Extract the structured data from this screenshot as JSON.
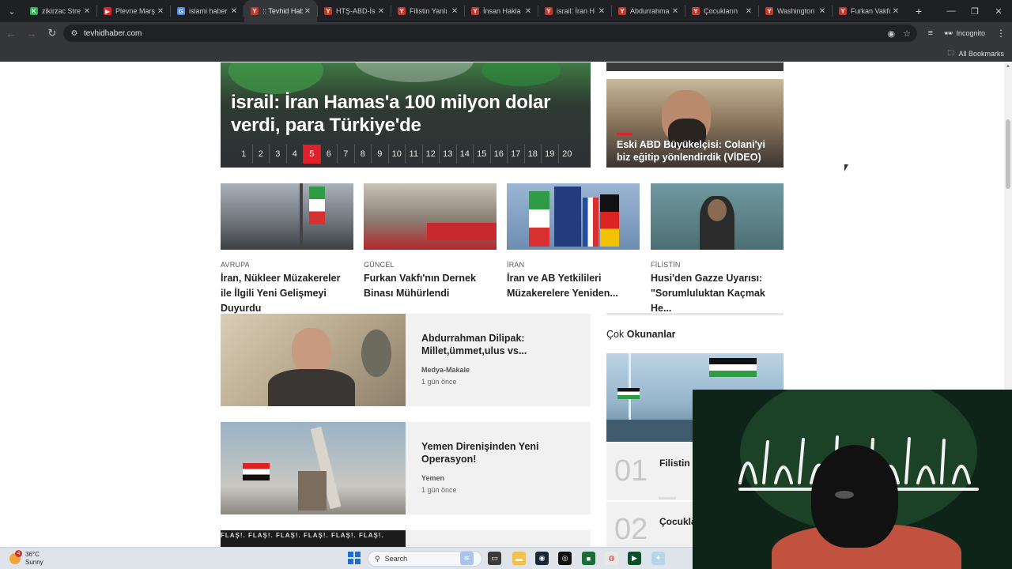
{
  "tabs": [
    {
      "label": "zikirzac Stre",
      "fav_color": "#2bb24c",
      "fav_glyph": "K",
      "active": false
    },
    {
      "label": "Plevne Marş",
      "fav_color": "#e02424",
      "fav_glyph": "▶",
      "active": false
    },
    {
      "label": "islami haber",
      "fav_color": "#4a8af4",
      "fav_glyph": "G",
      "active": false
    },
    {
      "label": ":: Tevhid Hab",
      "fav_color": "#c0392b",
      "fav_glyph": "Y",
      "active": true
    },
    {
      "label": "HTŞ-ABD-İs",
      "fav_color": "#c0392b",
      "fav_glyph": "Y",
      "active": false
    },
    {
      "label": "Filistin Yanlı",
      "fav_color": "#c0392b",
      "fav_glyph": "Y",
      "active": false
    },
    {
      "label": "İnsan Hakla",
      "fav_color": "#c0392b",
      "fav_glyph": "Y",
      "active": false
    },
    {
      "label": "israil: İran H",
      "fav_color": "#c0392b",
      "fav_glyph": "Y",
      "active": false
    },
    {
      "label": "Abdurrahma",
      "fav_color": "#c0392b",
      "fav_glyph": "Y",
      "active": false
    },
    {
      "label": "Çocukların",
      "fav_color": "#c0392b",
      "fav_glyph": "Y",
      "active": false
    },
    {
      "label": "Washington",
      "fav_color": "#c0392b",
      "fav_glyph": "Y",
      "active": false
    },
    {
      "label": "Furkan Vakfı",
      "fav_color": "#c0392b",
      "fav_glyph": "Y",
      "active": false
    }
  ],
  "omnibox": {
    "url": "tevhidhaber.com"
  },
  "toolbar": {
    "incognito_label": "Incognito"
  },
  "bookmarks": {
    "all_label": "All Bookmarks"
  },
  "hero": {
    "title": "israil: İran Hamas'a 100 milyon dolar verdi, para Türkiye'de",
    "pages": [
      "1",
      "2",
      "3",
      "4",
      "5",
      "6",
      "7",
      "8",
      "9",
      "10",
      "11",
      "12",
      "13",
      "14",
      "15",
      "16",
      "17",
      "18",
      "19",
      "20"
    ],
    "active_page": "5"
  },
  "side_card": {
    "title": "Eski ABD Büyükelçisi: Colani'yi biz eğitip yönlendirdik (VİDEO)"
  },
  "grid": [
    {
      "category": "AVRUPA",
      "title": "İran, Nükleer Müzakereler ile İlgili Yeni Gelişmeyi Duyurdu"
    },
    {
      "category": "GÜNCEL",
      "title": "Furkan Vakfı'nın Dernek Binası Mühürlendi"
    },
    {
      "category": "İRAN",
      "title": "İran ve AB Yetkilileri Müzakerelere Yeniden..."
    },
    {
      "category": "FİLİSTİN",
      "title": "Husi'den Gazze Uyarısı: \"Sorumluluktan Kaçmak He..."
    }
  ],
  "wide_articles": [
    {
      "title": "Abdurrahman Dilipak: Millet,ümmet,ulus vs...",
      "category": "Medya-Makale",
      "date": "1 gün önce"
    },
    {
      "title": "Yemen Direnişinden Yeni Operasyon!",
      "category": "Yemen",
      "date": "1 gün önce"
    }
  ],
  "flas_text": "FLAŞ!. FLAŞ!. FLAŞ!. FLAŞ!. FLAŞ!. FLAŞ!.",
  "most_read": {
    "heading_light": "Çok",
    "heading_bold": "Okunanlar",
    "items": [
      {
        "num": "01",
        "title": "Filistin Aktivist"
      },
      {
        "num": "02",
        "title": "Çocukla İçin Yiy"
      }
    ]
  },
  "taskbar": {
    "temperature": "36°C",
    "condition": "Sunny",
    "badge": "4",
    "search_placeholder": "Search"
  }
}
